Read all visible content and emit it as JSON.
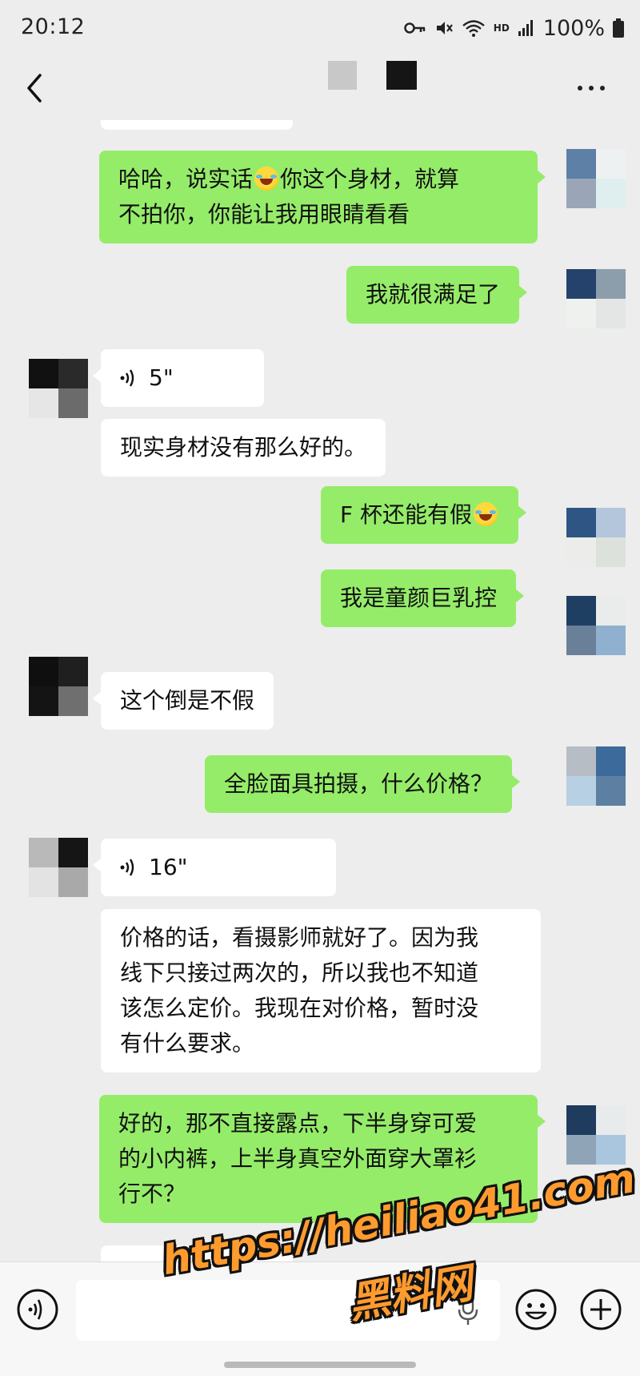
{
  "status_bar": {
    "time": "20:12",
    "network_label": "HD",
    "battery": "100%"
  },
  "header": {
    "back_icon": "chevron-left-icon",
    "more_icon": "more-horizontal-icon"
  },
  "messages": [
    {
      "sender": "me",
      "type": "text",
      "lines": [
        "哈哈，说实话",
        "不拍你，你能让我用眼睛看看"
      ],
      "emoji_after_line_0_prefix": "哈哈，说实话",
      "line0_suffix": "你这个身材，就算"
    },
    {
      "sender": "me",
      "type": "text",
      "lines": [
        "我就很满足了"
      ]
    },
    {
      "sender": "them",
      "type": "voice",
      "duration": "5\""
    },
    {
      "sender": "them",
      "type": "text",
      "lines": [
        "现实身材没有那么好的。"
      ]
    },
    {
      "sender": "me",
      "type": "text",
      "lines": [
        "F 杯还能有假"
      ]
    },
    {
      "sender": "me",
      "type": "text",
      "lines": [
        "我是童颜巨乳控"
      ]
    },
    {
      "sender": "them",
      "type": "text",
      "lines": [
        "这个倒是不假"
      ]
    },
    {
      "sender": "me",
      "type": "text",
      "lines": [
        "全脸面具拍摄，什么价格？"
      ]
    },
    {
      "sender": "them",
      "type": "voice",
      "duration": "16\""
    },
    {
      "sender": "them",
      "type": "text",
      "lines": [
        "价格的话，看摄影师就好了。因为我",
        "线下只接过两次的，所以我也不知道",
        "该怎么定价。我现在对价格，暂时没",
        "有什么要求。"
      ]
    },
    {
      "sender": "me",
      "type": "text",
      "lines": [
        "好的，那不直接露点，下半身穿可爱",
        "的小内裤，上半身真空外面穿大罩衫",
        "行不？"
      ]
    }
  ],
  "input_bar": {
    "input_value": "",
    "voice_icon": "voice-toggle-icon",
    "mic_icon": "microphone-icon",
    "emoji_icon": "emoji-icon",
    "plus_icon": "plus-icon"
  },
  "watermark": {
    "url": "https://heiliao41.com",
    "name": "黑料网"
  },
  "colors": {
    "background": "#ededed",
    "my_bubble": "#95ec69",
    "their_bubble": "#ffffff",
    "watermark": "#ff9b2e"
  }
}
